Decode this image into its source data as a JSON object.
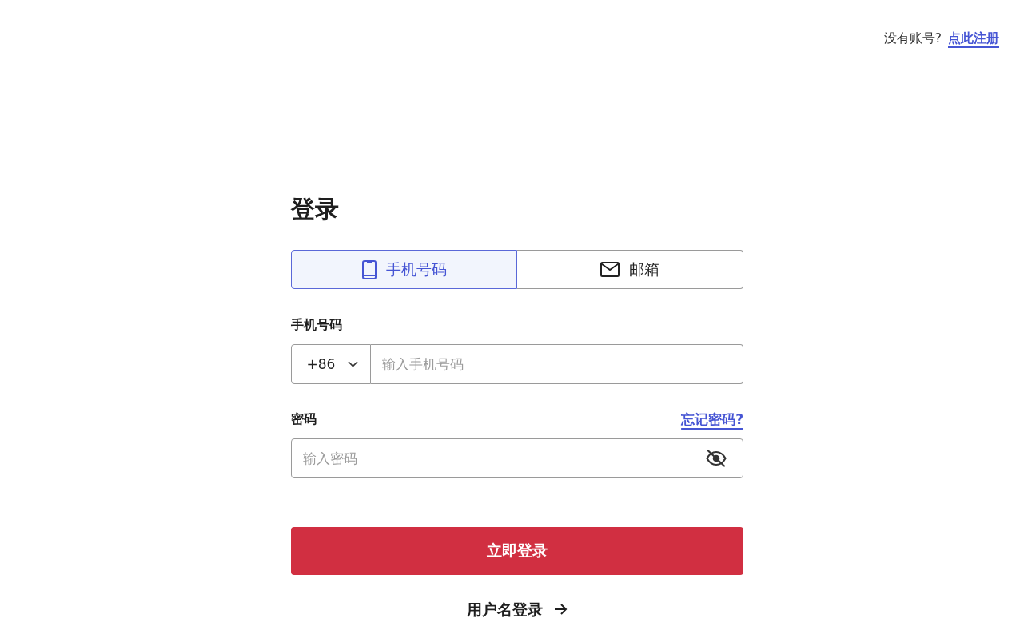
{
  "header": {
    "prompt": "没有账号?",
    "register_link": "点此注册"
  },
  "title": "登录",
  "tabs": [
    {
      "kind": "phone",
      "label": "手机号码",
      "selected": true
    },
    {
      "kind": "email",
      "label": "邮箱",
      "selected": false
    }
  ],
  "phone_field": {
    "label": "手机号码",
    "country_code": "+86",
    "placeholder": "输入手机号码"
  },
  "password_field": {
    "label": "密码",
    "forgot_link": "忘记密码?",
    "placeholder": "输入密码",
    "visible": false
  },
  "submit_button": "立即登录",
  "alt_login": {
    "label": "用户名登录"
  }
}
